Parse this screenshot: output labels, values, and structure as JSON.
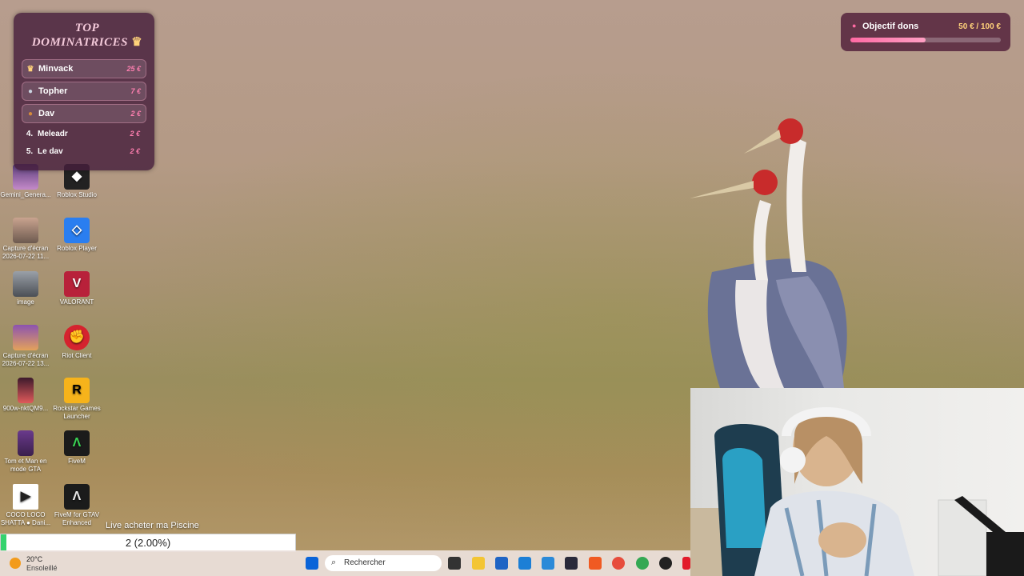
{
  "desktop": {
    "icons": [
      {
        "label": "Gemini_Genera...",
        "name": "desktop-icon-gemini"
      },
      {
        "label": "Roblox Studio",
        "name": "desktop-icon-roblox-studio"
      },
      {
        "label": "Capture d'écran 2026-07-22 11...",
        "name": "desktop-icon-capture-1"
      },
      {
        "label": "Roblox Player",
        "name": "desktop-icon-roblox-player"
      },
      {
        "label": "image",
        "name": "desktop-icon-image"
      },
      {
        "label": "VALORANT",
        "name": "desktop-icon-valorant"
      },
      {
        "label": "Capture d'écran 2026-07-22 13...",
        "name": "desktop-icon-capture-2"
      },
      {
        "label": "Riot Client",
        "name": "desktop-icon-riot-client"
      },
      {
        "label": "900w-nktQM9...",
        "name": "desktop-icon-900w"
      },
      {
        "label": "Rockstar Games Launcher",
        "name": "desktop-icon-rockstar"
      },
      {
        "label": "Tom et Man en mode GTA",
        "name": "desktop-icon-tom-man"
      },
      {
        "label": "FiveM",
        "name": "desktop-icon-fivem"
      },
      {
        "label": "COCO LOCO SHATTA ● Dani...",
        "name": "desktop-icon-coco-loco"
      },
      {
        "label": "FiveM for GTAV Enhanced",
        "name": "desktop-icon-fivem-enhanced"
      }
    ]
  },
  "top_widget": {
    "title_line1": "TOP",
    "title_line2": "DOMINATRICES",
    "ranks": [
      {
        "marker": "♛",
        "name": "Minvack",
        "amount": "25 €"
      },
      {
        "marker": "●",
        "name": "Topher",
        "amount": "7 €"
      },
      {
        "marker": "●",
        "name": "Dav",
        "amount": "2 €"
      },
      {
        "marker": "4.",
        "name": "Meleadr",
        "amount": "2 €"
      },
      {
        "marker": "5.",
        "name": "Le dav",
        "amount": "2 €"
      }
    ]
  },
  "goal": {
    "label": "Objectif dons",
    "amount": "50 € / 100 €",
    "progress": 0.5
  },
  "subgoal": {
    "title": "Live acheter ma Piscine",
    "value": "2 (2.00%)",
    "progress": 0.02
  },
  "taskbar": {
    "weather_temp": "20°C",
    "weather_text": "Ensoleillé",
    "search_placeholder": "Rechercher"
  },
  "colors": {
    "accent": "#ff6aa3",
    "widget_bg": "#461e3c",
    "subgoal_fill": "#35d36e"
  }
}
